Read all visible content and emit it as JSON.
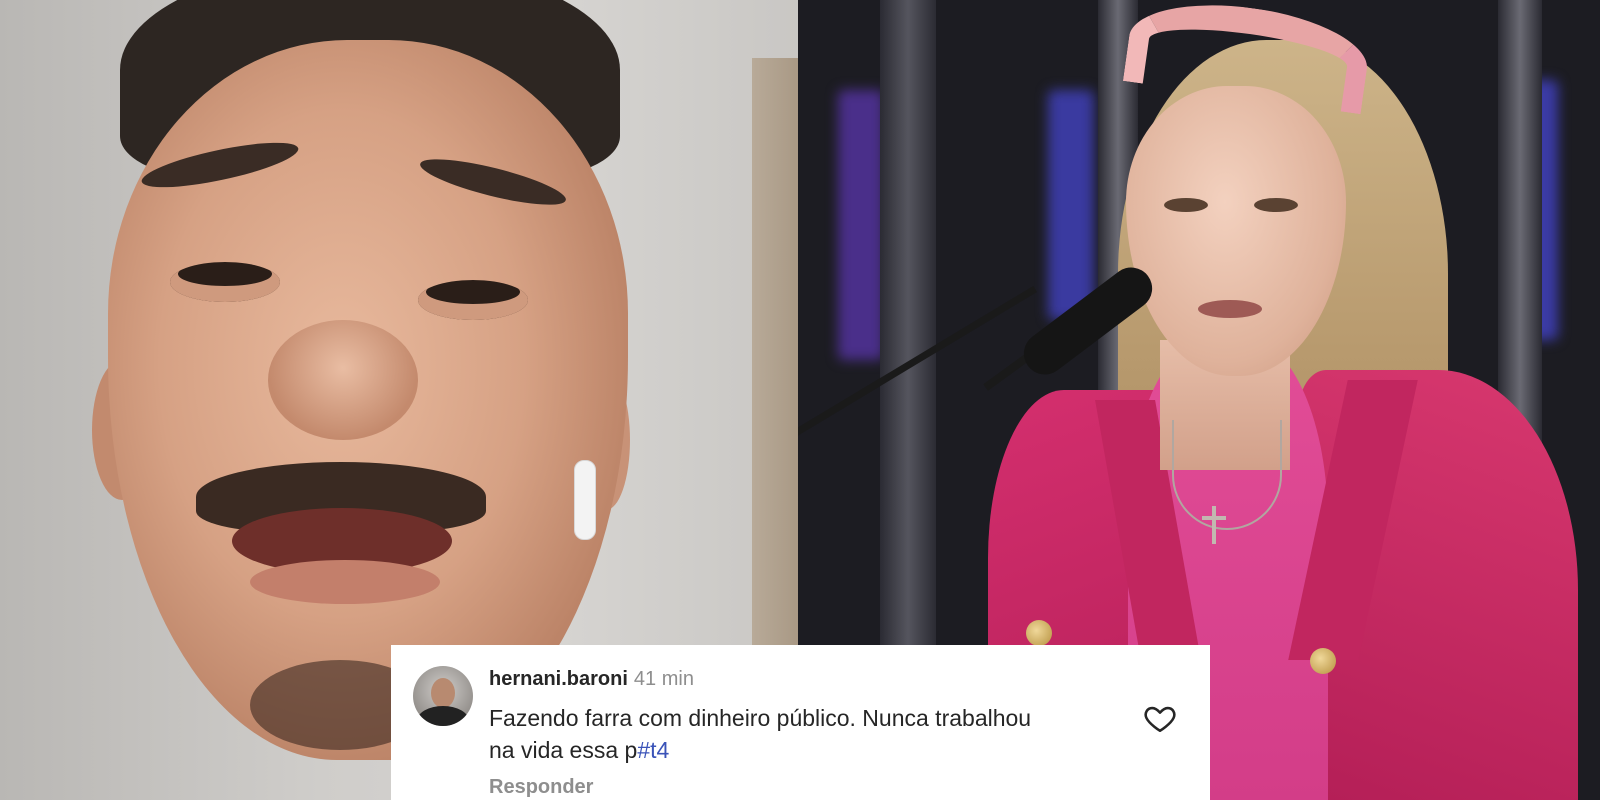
{
  "comment": {
    "username": "hernani.baroni",
    "time": "41 min",
    "text_main": "Fazendo farra com dinheiro público. Nunca trabalhou na vida essa p",
    "text_censored": "#t4",
    "reply_label": "Responder",
    "like_icon": "heart-outline-icon",
    "avatar_icon": "user-avatar"
  },
  "colors": {
    "mention": "#3a53b8",
    "username": "#262626",
    "muted": "#8e8e8e",
    "card_bg": "#ffffff"
  }
}
